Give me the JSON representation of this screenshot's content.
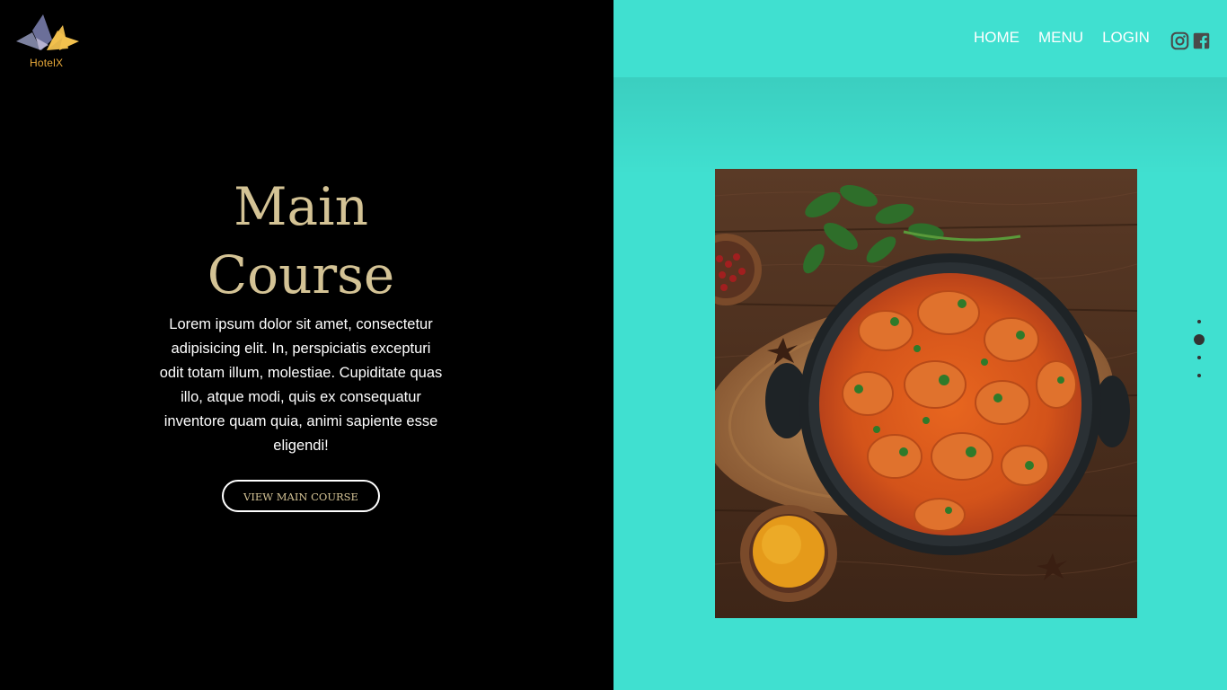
{
  "brand": {
    "logo_text": "HotelX",
    "accent_color": "#e8a93a"
  },
  "nav": {
    "items": [
      {
        "label": "HOME"
      },
      {
        "label": "MENU"
      },
      {
        "label": "LOGIN"
      }
    ],
    "social": [
      {
        "icon": "instagram-icon"
      },
      {
        "icon": "facebook-icon"
      }
    ]
  },
  "hero": {
    "title_line1": "Main",
    "title_line2": "Course",
    "description": "Lorem ipsum dolor sit amet, consectetur adipisicing elit. In, perspiciatis excepturi odit totam illum, molestiae. Cupiditate quas illo, atque modi, quis ex consequatur inventore quam quia, animi sapiente esse eligendi!",
    "button_label": "VIEW MAIN COURSE"
  },
  "slider": {
    "total": 4,
    "active_index": 2
  },
  "colors": {
    "left_bg": "#000000",
    "right_bg": "#40E0D0",
    "title_gold": "#d4c395"
  }
}
